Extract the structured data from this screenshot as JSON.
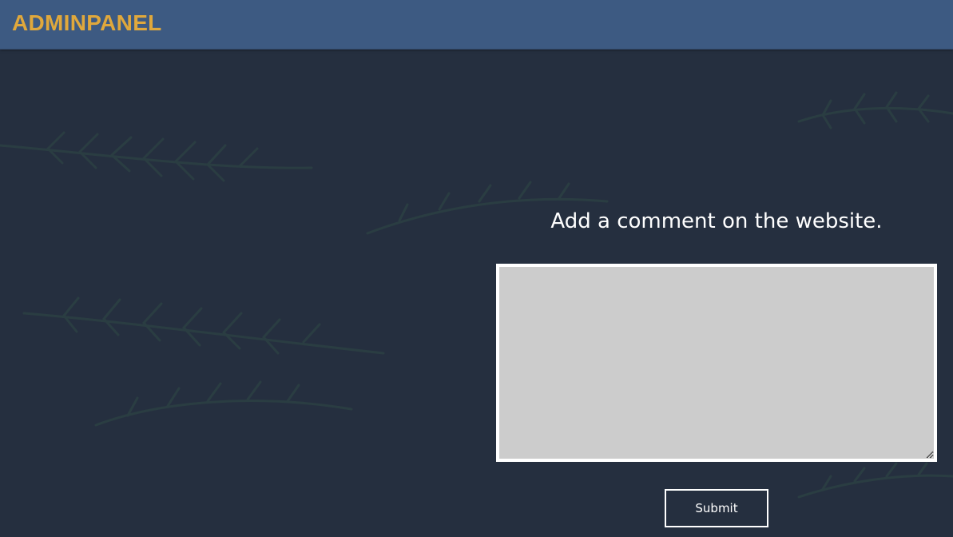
{
  "header": {
    "brand": "ADMINPANEL"
  },
  "main": {
    "heading": "Add a comment on the website.",
    "comment": {
      "value": "",
      "placeholder": ""
    },
    "submit_label": "Submit"
  },
  "colors": {
    "header_bg": "#3d5a82",
    "brand": "#e0a83c",
    "page_bg": "#252f3f",
    "textarea_bg": "#cccccc"
  }
}
